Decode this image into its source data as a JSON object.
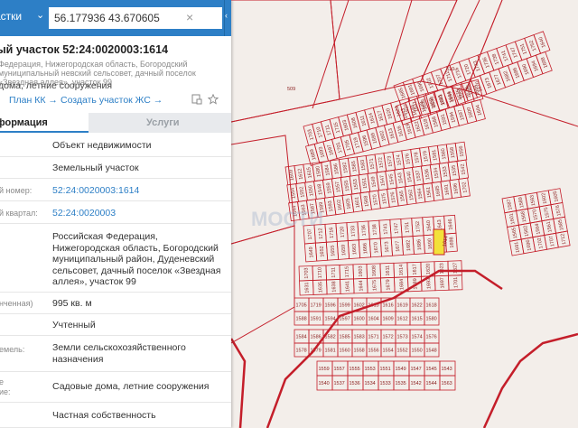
{
  "search": {
    "layer_label": "астки",
    "value": "56.177936 43.670605",
    "clear_glyph": "×"
  },
  "panel": {
    "title": "ый участок 52:24:0020003:1614",
    "address": "Федерация, Нижегородская область, Богородский муниципальный невский сельсовет, дачный поселок «Звездная аллея», участок 99",
    "purpose_short": "дома, летние сооружения",
    "actions": {
      "plan_kk": "План КК",
      "create_zhs": "Создать участок ЖС"
    },
    "tabs": {
      "info": "формация",
      "services": "Услуги"
    },
    "rows": [
      {
        "label": "",
        "value": "Объект недвижимости"
      },
      {
        "label": "",
        "value": "Земельный участок"
      },
      {
        "label": "й номер:",
        "value": "52:24:0020003:1614"
      },
      {
        "label": "й квартал:",
        "value": "52:24:0020003"
      },
      {
        "label": "",
        "value": "Российская Федерация, Нижегородская область, Богородский муниципальный район, Дуденевский сельсовет, дачный поселок «Звездная аллея», участок 99"
      },
      {
        "label": "нченная)",
        "value": "995 кв. м"
      },
      {
        "label": "",
        "value": "Учтенный"
      },
      {
        "label": "емель:",
        "value": "Земли сельскохозяйственного назначения"
      },
      {
        "label": "е\nие:",
        "value": "Садовые дома, летние сооружения"
      },
      {
        "label": "",
        "value": "Частная собственность"
      }
    ]
  },
  "map": {
    "watermark": "МОСТИ",
    "labels_large": [
      "510",
      "509"
    ],
    "parcels": [
      "1685",
      "1691",
      "1696",
      "1702",
      "1707",
      "1712",
      "1716",
      "1720",
      "1733",
      "1736",
      "1738",
      "1741",
      "1747",
      "1751",
      "1752",
      "1640",
      "1643",
      "1646",
      "1649",
      "1652",
      "1655",
      "1659",
      "1663",
      "1666",
      "1670",
      "1673",
      "1677",
      "1682",
      "1686",
      "1690",
      "1694",
      "1698",
      "1703",
      "1710",
      "1711",
      "1715",
      "1603",
      "1608",
      "1611",
      "1614",
      "1617",
      "1620",
      "1623",
      "1627",
      "1631",
      "1635",
      "1638",
      "1641",
      "1644",
      "1675",
      "1679",
      "1684",
      "1689",
      "1693",
      "1697",
      "1701",
      "1705",
      "1719",
      "1596",
      "1599",
      "1602",
      "1613",
      "1616",
      "1619",
      "1622",
      "1618",
      "1588",
      "1591",
      "1594",
      "1597",
      "1600",
      "1604",
      "1609",
      "1612",
      "1615",
      "1580",
      "1584",
      "1586",
      "1582",
      "1585",
      "1583",
      "1571",
      "1572",
      "1573",
      "1574",
      "1576",
      "1578",
      "1579",
      "1581",
      "1560",
      "1558",
      "1556",
      "1554",
      "1552",
      "1550",
      "1548",
      "1559",
      "1557",
      "1555",
      "1553",
      "1551",
      "1549",
      "1547",
      "1545",
      "1543",
      "1540",
      "1537",
      "1536",
      "1534",
      "1533",
      "1535",
      "1542",
      "1544",
      "1563",
      "1587",
      "1589",
      "1593",
      "1602",
      "1605",
      "1601",
      "1568",
      "1570",
      "1575",
      "1576",
      "1565",
      "1562",
      "1564",
      "1561"
    ],
    "colors": {
      "line": "#c41e2a",
      "parcel_bg": "#f3eeea",
      "highlight": "#f2e13a",
      "panel_accent": "#2d7fc6"
    }
  }
}
